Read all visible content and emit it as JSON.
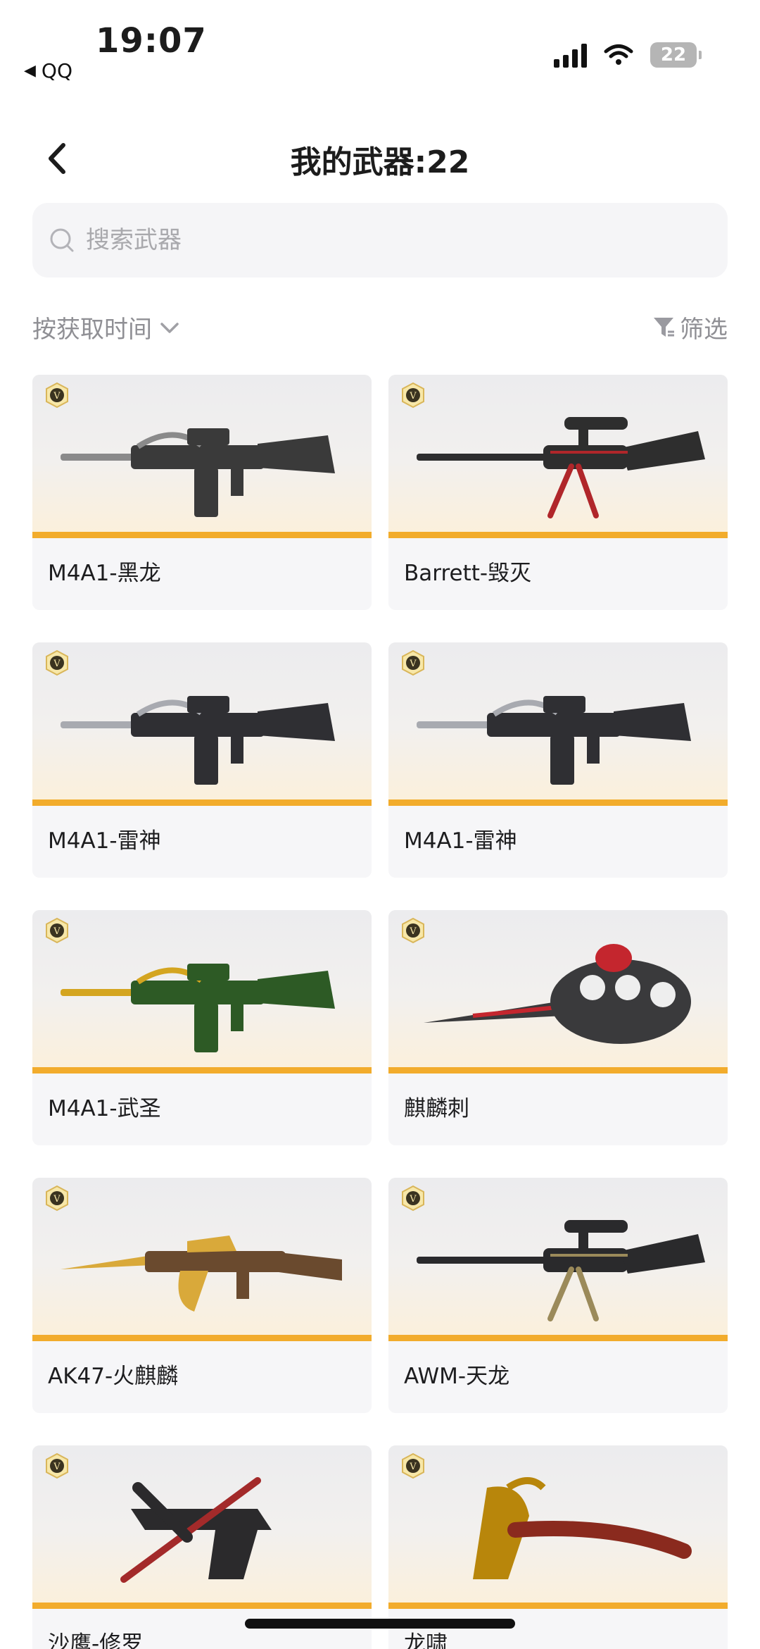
{
  "status_bar": {
    "time": "19:07",
    "back_app": "QQ",
    "battery": "22"
  },
  "nav": {
    "title": "我的武器:22"
  },
  "search": {
    "placeholder": "搜索武器"
  },
  "toolbar": {
    "sort_label": "按获取时间",
    "filter_label": "筛选"
  },
  "colors": {
    "accent": "#f2ac2c",
    "card_bg": "#f6f6f8",
    "muted_text": "#8f8f94"
  },
  "weapons": [
    {
      "name": "M4A1-黑龙",
      "icon": "rifle-icon",
      "tint": "#3a3a3a",
      "trim": "#8a8a8a"
    },
    {
      "name": "Barrett-毁灭",
      "icon": "sniper-icon",
      "tint": "#2e2e2e",
      "trim": "#b0262a"
    },
    {
      "name": "M4A1-雷神",
      "icon": "rifle-icon",
      "tint": "#2f2f33",
      "trim": "#a8aab0"
    },
    {
      "name": "M4A1-雷神",
      "icon": "rifle-icon",
      "tint": "#2f2f33",
      "trim": "#a8aab0"
    },
    {
      "name": "M4A1-武圣",
      "icon": "rifle-icon",
      "tint": "#2d5a25",
      "trim": "#d4a520"
    },
    {
      "name": "麒麟刺",
      "icon": "knuckle-knife-icon",
      "tint": "#3a3a3c",
      "trim": "#c4262e"
    },
    {
      "name": "AK47-火麒麟",
      "icon": "assault-rifle-icon",
      "tint": "#6a4a2e",
      "trim": "#d9a93a"
    },
    {
      "name": "AWM-天龙",
      "icon": "sniper-icon",
      "tint": "#2a2a2c",
      "trim": "#9b8a5a"
    },
    {
      "name": "沙鹰-修罗",
      "icon": "pistol-icon",
      "tint": "#2b2a2c",
      "trim": "#a32a2a"
    },
    {
      "name": "龙啸",
      "icon": "axe-icon",
      "tint": "#b8860b",
      "trim": "#8a2a1e"
    }
  ]
}
